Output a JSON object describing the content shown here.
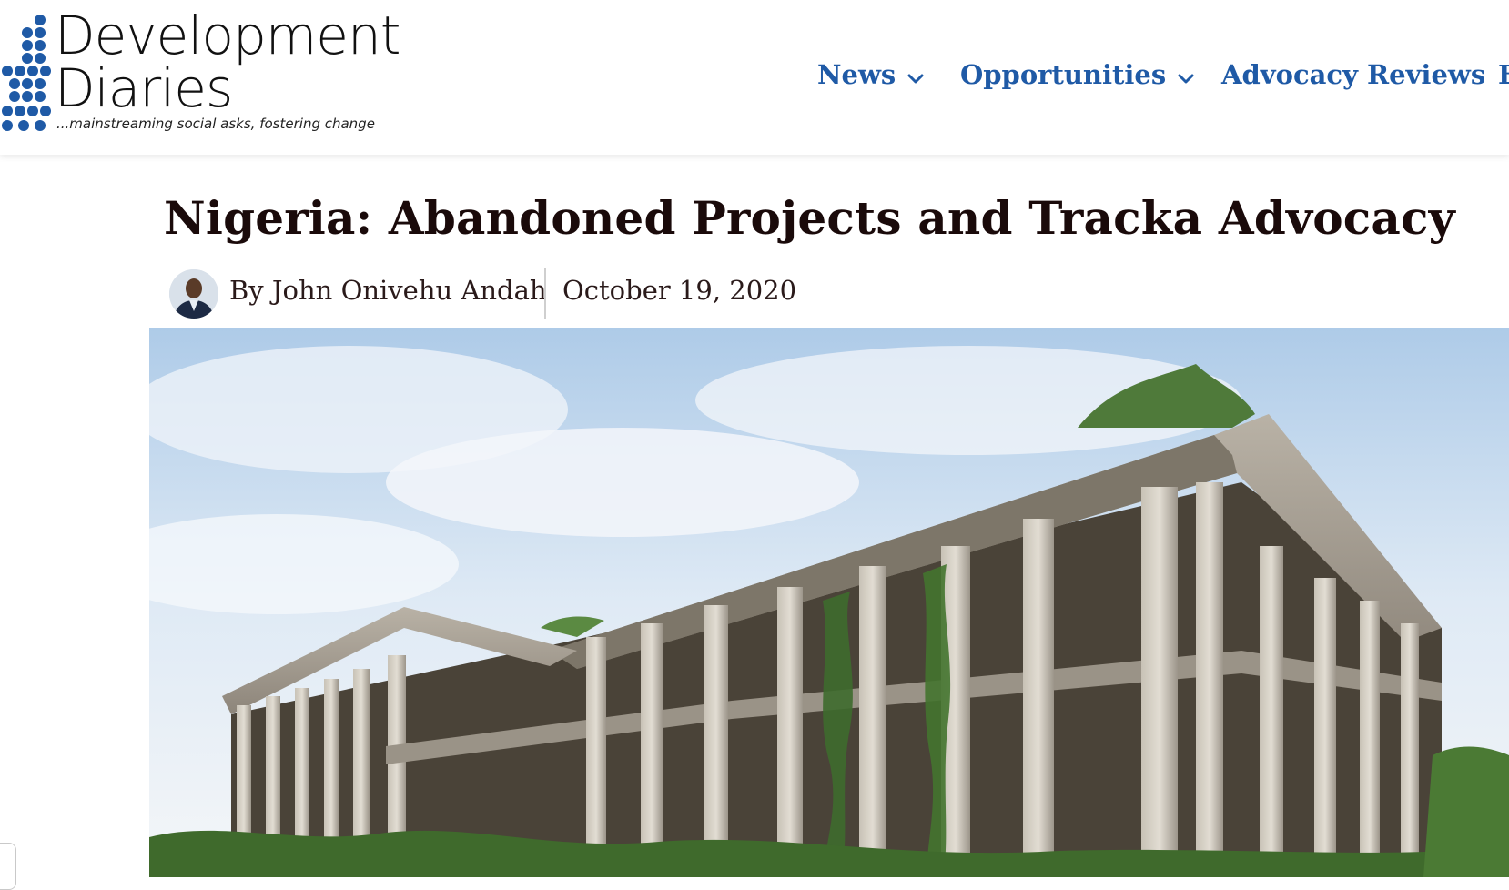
{
  "header": {
    "logo": {
      "title_line1": "Development",
      "title_line2": "Diaries",
      "tagline": "...mainstreaming social asks, fostering change",
      "brand_color": "#1f5aa6"
    },
    "nav": {
      "items": [
        {
          "label": "News",
          "has_dropdown": true,
          "icon": "chevron-down-icon"
        },
        {
          "label": "Opportunities",
          "has_dropdown": true,
          "icon": "chevron-down-icon"
        },
        {
          "label": "Advocacy Reviews",
          "has_dropdown": false
        },
        {
          "label": "E",
          "has_dropdown": false
        }
      ],
      "color": "#1f5aa6"
    }
  },
  "article": {
    "title": "Nigeria: Abandoned Projects and Tracka Advocacy",
    "byline": "By John Onivehu Andah",
    "date": "October 19, 2020",
    "avatar_icon": "author-avatar",
    "hero_image": "abandoned-building-photo"
  }
}
